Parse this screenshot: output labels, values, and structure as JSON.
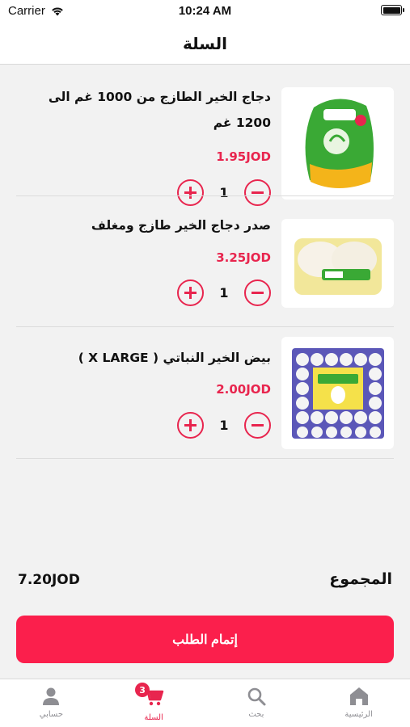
{
  "status_bar": {
    "carrier": "Carrier",
    "time": "10:24 AM"
  },
  "nav": {
    "title": "السلة"
  },
  "cart": {
    "items": [
      {
        "name": "دجاج الخير الطازج من 1000 غم الى 1200 غم",
        "price": "1.95JOD",
        "quantity": "1",
        "image_icon": "whole-chicken-image"
      },
      {
        "name": "صدر دجاج الخير طازج ومغلف",
        "price": "3.25JOD",
        "quantity": "1",
        "image_icon": "chicken-breast-image"
      },
      {
        "name": "بيض الخير النباتي ( X LARGE )",
        "price": "2.00JOD",
        "quantity": "1",
        "image_icon": "egg-tray-image"
      }
    ]
  },
  "summary": {
    "total_label": "المجموع",
    "total_value": "7.20JOD"
  },
  "checkout": {
    "label": "إتمام الطلب"
  },
  "tabbar": {
    "badge": "3",
    "tabs": [
      {
        "label": "حسابي",
        "icon": "person-icon"
      },
      {
        "label": "السلة",
        "icon": "cart-icon"
      },
      {
        "label": "بحث",
        "icon": "search-icon"
      },
      {
        "label": "الرئيسية",
        "icon": "home-icon"
      }
    ]
  },
  "colors": {
    "accent": "#e8254e",
    "button": "#fb1f4c",
    "background": "#f2f2f2"
  }
}
